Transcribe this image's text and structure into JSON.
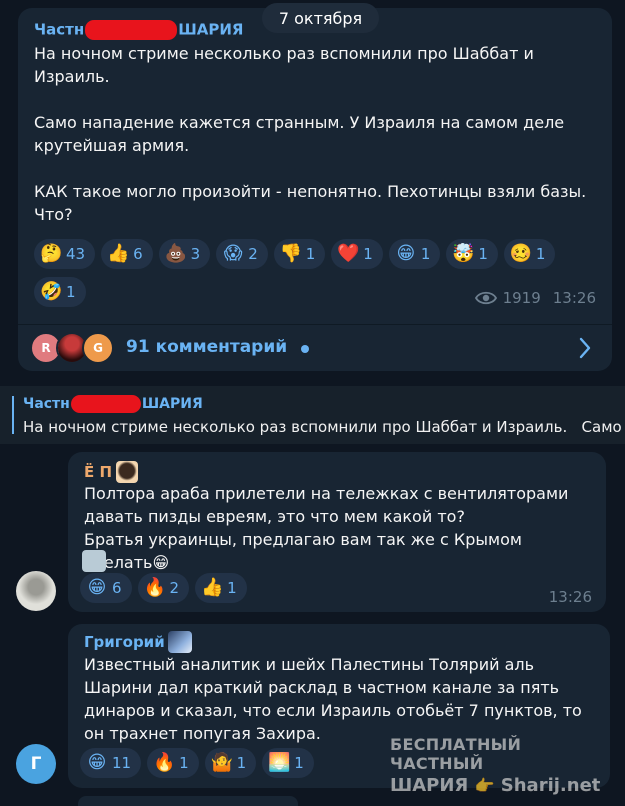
{
  "date_pill": "7 октября",
  "post": {
    "author_prefix": "Частн",
    "author_suffix": "ШАРИЯ",
    "text": "На ночном стриме несколько раз вспомнили про Шаббат и Израиль.\n\nСамо нападение кажется странным. У Израиля на самом деле крутейшая армия.\n\nКАК такое могло произойти - непонятно. Пехотинцы взяли базы. Что?",
    "reactions": [
      {
        "emoji": "🤔",
        "count": "43"
      },
      {
        "emoji": "👍",
        "count": "6"
      },
      {
        "emoji": "💩",
        "count": "3"
      },
      {
        "emoji": "😱",
        "count": "2"
      },
      {
        "emoji": "👎",
        "count": "1"
      },
      {
        "emoji": "❤️",
        "count": "1"
      },
      {
        "emoji": "😁",
        "count": "1"
      },
      {
        "emoji": "🤯",
        "count": "1"
      },
      {
        "emoji": "🥴",
        "count": "1"
      },
      {
        "emoji": "🤣",
        "count": "1"
      }
    ],
    "views": "1919",
    "time": "13:26",
    "comments_label": "91 комментарий",
    "comment_avatars": [
      "R",
      "",
      "G"
    ]
  },
  "reply_preview": {
    "author_prefix": "Частн",
    "author_suffix": "ШАРИЯ",
    "text": "На ночном стриме несколько раз вспомнили про Шаббат и Израиль.   Само н"
  },
  "comments": [
    {
      "author": "Ё П",
      "text": "Полтора араба прилетели на тележках с вентиляторами давать пизды евреям, это что мем какой то?\nБратья украинцы, предлагаю вам так же с Крымом сделать😁",
      "reactions": [
        {
          "emoji": "😁",
          "count": "6"
        },
        {
          "emoji": "🔥",
          "count": "2"
        },
        {
          "emoji": "👍",
          "count": "1"
        }
      ],
      "time": "13:26"
    },
    {
      "author": "Григорий",
      "avatar_letter": "Г",
      "text": "Известный аналитик и шейх Палестины Толярий аль Шарини дал краткий расклад в частном канале за пять динаров и сказал, что если Израиль отобьёт 7 пунктов, то он трахнет попугая Захира.",
      "reactions": [
        {
          "emoji": "😁",
          "count": "11"
        },
        {
          "emoji": "🔥",
          "count": "1"
        },
        {
          "emoji": "🤷",
          "count": "1"
        },
        {
          "emoji": "🌅",
          "count": "1"
        }
      ]
    }
  ],
  "watermark": {
    "line1": "БЕСПЛАТНЫЙ ЧАСТНЫЙ",
    "line2_a": "ШАРИЯ",
    "line2_b": "Sharij.net"
  },
  "colors": {
    "background": "#0e1621",
    "bubble": "#182533",
    "accent": "#6ab3f3",
    "redaction": "#e8141c"
  }
}
